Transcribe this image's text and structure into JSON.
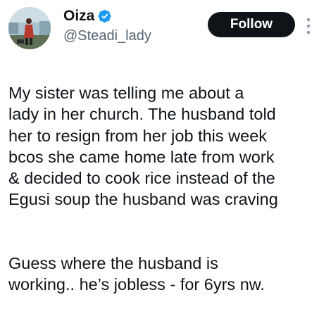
{
  "author": {
    "display_name": "Oiza",
    "handle": "@Steadi_lady",
    "verified": true,
    "avatar_icon": "profile-photo"
  },
  "actions": {
    "follow_label": "Follow",
    "more_icon": "more-options-icon"
  },
  "tweet": {
    "paragraphs": [
      "My sister was telling me about a\nlady in her church. The husband told\nher to resign from her job this week\nbcos she came home late from work\n& decided to cook rice instead of the\nEgusi soup the husband was craving",
      "Guess where the husband is\nworking.. he’s jobless - for 6yrs nw."
    ]
  },
  "colors": {
    "verified_badge": "#1d9bf0",
    "follow_button_bg": "#0f1419",
    "secondary_text": "#536471"
  }
}
